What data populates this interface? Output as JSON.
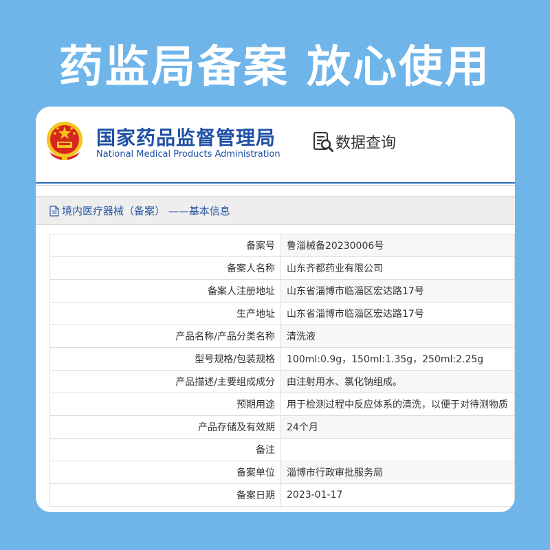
{
  "banner": {
    "headline": "药监局备案 放心使用"
  },
  "site": {
    "name_cn": "国家药品监督管理局",
    "name_en": "National Medical Products Administration",
    "query_label": "数据查询"
  },
  "section": {
    "title": "境内医疗器械（备案） ——基本信息"
  },
  "record": {
    "rows": [
      {
        "label": "备案号",
        "value": "鲁淄械备20230006号"
      },
      {
        "label": "备案人名称",
        "value": "山东齐都药业有限公司"
      },
      {
        "label": "备案人注册地址",
        "value": "山东省淄博市临淄区宏达路17号"
      },
      {
        "label": "生产地址",
        "value": "山东省淄博市临淄区宏达路17号"
      },
      {
        "label": "产品名称/产品分类名称",
        "value": "清洗液"
      },
      {
        "label": "型号规格/包装规格",
        "value": "100ml:0.9g，150ml:1.35g，250ml:2.25g"
      },
      {
        "label": "产品描述/主要组成成分",
        "value": "由注射用水、氯化钠组成。"
      },
      {
        "label": "预期用途",
        "value": "用于检测过程中反应体系的清洗，以便于对待测物质"
      },
      {
        "label": "产品存储及有效期",
        "value": "24个月"
      },
      {
        "label": "备注",
        "value": ""
      },
      {
        "label": "备案单位",
        "value": "淄博市行政审批服务局"
      },
      {
        "label": "备案日期",
        "value": "2023-01-17"
      }
    ]
  },
  "colors": {
    "background": "#6fb5ea",
    "brand_blue": "#1f4fa6",
    "emblem_red": "#d7261e",
    "emblem_gold": "#f4c51e"
  },
  "icons": {
    "emblem": "national-emblem-icon",
    "query": "search-document-icon",
    "section": "document-icon"
  }
}
